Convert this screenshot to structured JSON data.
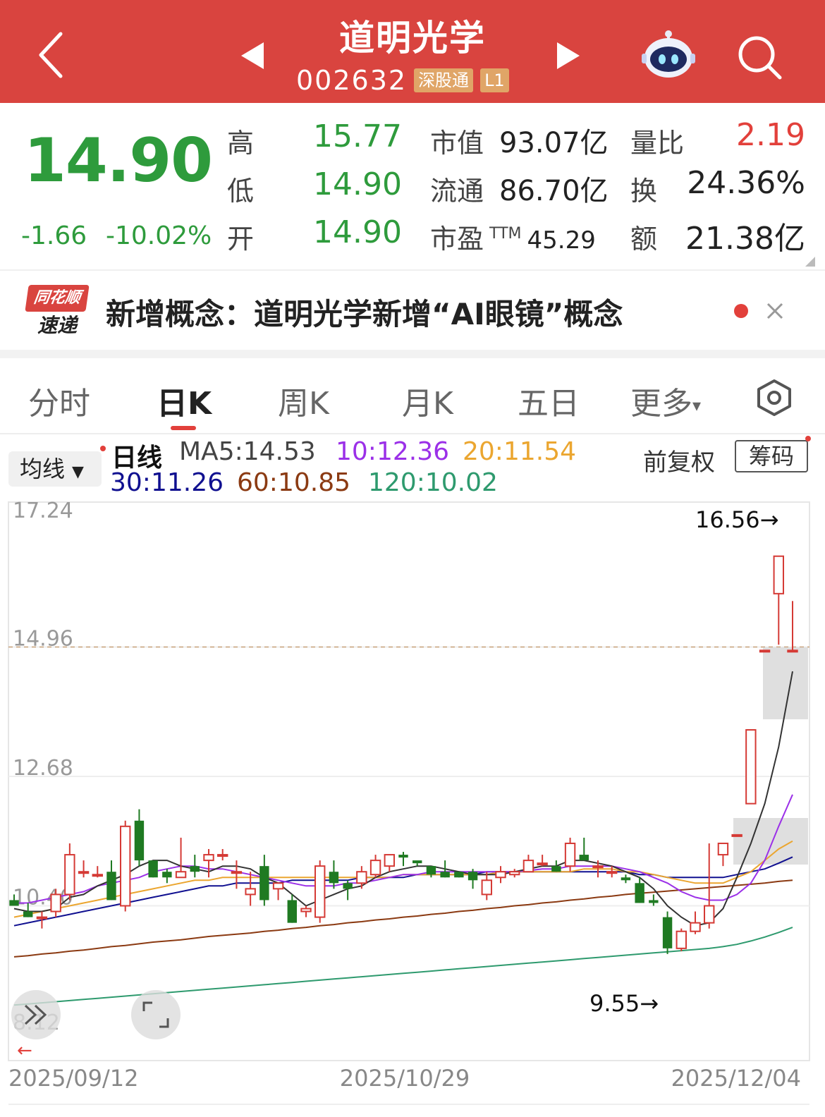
{
  "header": {
    "title": "道明光学",
    "code": "002632",
    "tag_connect": "深股通",
    "tag_level": "L1",
    "icons": [
      "back-icon",
      "prev-stock-icon",
      "next-stock-icon",
      "assistant-robot-icon",
      "search-icon"
    ]
  },
  "quote": {
    "price": "14.90",
    "change": "-1.66",
    "change_pct": "-10.02%",
    "high_label": "高",
    "high": "15.77",
    "low_label": "低",
    "low": "14.90",
    "open_label": "开",
    "open": "14.90",
    "mcap_label": "市值",
    "mcap": "93.07亿",
    "float_label": "流通",
    "float": "86.70亿",
    "pe_label": "市盈",
    "pe_ttm": "TTM",
    "pe": "45.29",
    "volratio_label": "量比",
    "volratio": "2.19",
    "turnover_label": "换",
    "turnover": "24.36%",
    "amount_label": "额",
    "amount": "21.38亿",
    "colors": {
      "down": "#2e9b3c",
      "up": "#e2403b"
    }
  },
  "news": {
    "logo_top": "同花顺",
    "logo_bottom": "速递",
    "text": "新增概念：道明光学新增“AI眼镜”概念"
  },
  "tabs": [
    "分时",
    "日K",
    "周K",
    "月K",
    "五日",
    "更多"
  ],
  "active_tab": "日K",
  "legend": {
    "selector": "均线",
    "period": "日线",
    "ma5": "MA5:14.53",
    "ma10": "10:12.36",
    "ma20": "20:11.54",
    "ma30": "30:11.26",
    "ma60": "60:10.85",
    "ma120": "120:10.02",
    "adjust": "前复权",
    "chip": "筹码",
    "colors": {
      "ma5": "#333333",
      "ma10": "#9b30e8",
      "ma20": "#eba630",
      "ma30": "#101090",
      "ma60": "#8b3a12",
      "ma120": "#2e9a6e"
    }
  },
  "chart_data": {
    "type": "candlestick",
    "y_ticks": [
      "17.24",
      "14.96",
      "12.68",
      "10.40",
      "8.12"
    ],
    "ylim": [
      8.12,
      17.24
    ],
    "x_ticks": [
      "2025/09/12",
      "2025/10/29",
      "2025/12/04"
    ],
    "annotations": {
      "max": "16.56→",
      "min": "9.55→",
      "last_close": 14.96
    },
    "grid": true,
    "candles": [
      [
        10.5,
        10.6,
        10.4,
        10.4
      ],
      [
        10.3,
        10.45,
        10.2,
        10.2
      ],
      [
        10.2,
        10.3,
        10.0,
        10.2
      ],
      [
        10.3,
        10.7,
        10.2,
        10.6
      ],
      [
        10.6,
        11.5,
        10.5,
        11.3
      ],
      [
        11.0,
        11.2,
        10.9,
        11.0
      ],
      [
        10.95,
        11.1,
        10.9,
        10.95
      ],
      [
        11.0,
        11.2,
        10.5,
        10.5
      ],
      [
        10.4,
        11.9,
        10.3,
        11.8
      ],
      [
        11.9,
        12.1,
        11.1,
        11.2
      ],
      [
        11.2,
        11.2,
        10.9,
        10.9
      ],
      [
        11.0,
        11.05,
        10.8,
        10.9
      ],
      [
        10.9,
        11.6,
        10.9,
        11.0
      ],
      [
        11.1,
        11.3,
        10.9,
        11.0
      ],
      [
        11.2,
        11.4,
        10.9,
        11.3
      ],
      [
        11.3,
        11.4,
        11.2,
        11.3
      ],
      [
        11.0,
        11.2,
        10.7,
        11.0
      ],
      [
        10.6,
        11.0,
        10.4,
        10.7
      ],
      [
        11.1,
        11.3,
        10.4,
        10.5
      ],
      [
        10.7,
        10.8,
        10.5,
        10.8
      ],
      [
        10.5,
        10.6,
        10.1,
        10.1
      ],
      [
        10.3,
        10.4,
        10.2,
        10.35
      ],
      [
        10.2,
        11.2,
        10.1,
        11.1
      ],
      [
        11.0,
        11.2,
        10.7,
        10.8
      ],
      [
        10.8,
        10.85,
        10.5,
        10.7
      ],
      [
        10.8,
        11.1,
        10.7,
        11.0
      ],
      [
        10.95,
        11.3,
        10.9,
        11.2
      ],
      [
        11.1,
        11.3,
        11.0,
        11.3
      ],
      [
        11.3,
        11.35,
        11.1,
        11.25
      ],
      [
        11.2,
        11.15,
        11.1,
        11.15
      ],
      [
        11.1,
        11.1,
        10.9,
        10.95
      ],
      [
        11.0,
        11.2,
        10.9,
        10.9
      ],
      [
        11.0,
        11.0,
        10.9,
        10.9
      ],
      [
        11.0,
        11.05,
        10.7,
        10.85
      ],
      [
        10.6,
        11.0,
        10.5,
        10.85
      ],
      [
        10.9,
        11.1,
        10.8,
        11.0
      ],
      [
        10.95,
        11.05,
        10.9,
        11.0
      ],
      [
        11.0,
        11.3,
        11.0,
        11.2
      ],
      [
        11.15,
        11.3,
        11.1,
        11.15
      ],
      [
        11.1,
        11.2,
        11.0,
        11.0
      ],
      [
        11.1,
        11.6,
        11.0,
        11.5
      ],
      [
        11.3,
        11.6,
        11.2,
        11.2
      ],
      [
        11.1,
        11.2,
        10.9,
        11.1
      ],
      [
        11.0,
        11.1,
        10.9,
        11.0
      ],
      [
        10.9,
        10.95,
        10.8,
        10.85
      ],
      [
        10.8,
        10.9,
        10.45,
        10.45
      ],
      [
        10.5,
        10.6,
        10.4,
        10.45
      ],
      [
        10.2,
        10.3,
        9.55,
        9.65
      ],
      [
        9.65,
        10.0,
        9.6,
        9.95
      ],
      [
        9.95,
        10.3,
        9.9,
        10.1
      ],
      [
        10.1,
        11.5,
        10.0,
        10.4
      ],
      [
        11.3,
        11.5,
        11.1,
        11.5
      ],
      [
        11.65,
        11.65,
        11.65,
        11.65
      ],
      [
        12.2,
        13.5,
        12.2,
        13.5
      ],
      [
        14.9,
        14.9,
        14.9,
        14.9
      ],
      [
        15.9,
        16.56,
        15.0,
        16.56
      ],
      [
        14.9,
        15.77,
        14.9,
        14.9
      ]
    ],
    "ma5": [
      10.35,
      10.3,
      10.3,
      10.35,
      10.55,
      10.6,
      10.75,
      10.85,
      10.95,
      11.1,
      11.2,
      11.2,
      11.1,
      11.05,
      11.0,
      11.1,
      11.1,
      11.05,
      10.9,
      10.8,
      10.6,
      10.4,
      10.5,
      10.6,
      10.7,
      10.75,
      10.9,
      11.0,
      11.05,
      11.1,
      11.1,
      11.05,
      11.0,
      10.95,
      10.95,
      10.95,
      11.0,
      11.05,
      11.1,
      11.1,
      11.2,
      11.2,
      11.15,
      11.1,
      11.0,
      10.9,
      10.7,
      10.4,
      10.2,
      10.05,
      10.1,
      10.35,
      10.9,
      11.5,
      12.2,
      13.2,
      14.53
    ],
    "ma10": [
      10.45,
      10.45,
      10.5,
      10.55,
      10.6,
      10.65,
      10.75,
      10.8,
      10.85,
      10.9,
      11.0,
      11.05,
      11.1,
      11.1,
      11.05,
      11.05,
      11.0,
      10.95,
      10.9,
      10.85,
      10.8,
      10.75,
      10.75,
      10.75,
      10.8,
      10.8,
      10.85,
      10.9,
      10.95,
      10.95,
      11.0,
      11.0,
      11.0,
      11.0,
      11.0,
      11.0,
      11.0,
      11.02,
      11.05,
      11.05,
      11.1,
      11.1,
      11.1,
      11.1,
      11.05,
      11.0,
      10.9,
      10.8,
      10.65,
      10.55,
      10.5,
      10.5,
      10.6,
      10.8,
      11.2,
      11.8,
      12.36
    ],
    "ma20": [
      10.2,
      10.25,
      10.3,
      10.35,
      10.4,
      10.45,
      10.5,
      10.55,
      10.6,
      10.65,
      10.7,
      10.75,
      10.8,
      10.85,
      10.85,
      10.9,
      10.9,
      10.9,
      10.9,
      10.9,
      10.9,
      10.9,
      10.9,
      10.9,
      10.9,
      10.9,
      10.9,
      10.9,
      10.95,
      10.95,
      10.95,
      10.95,
      10.95,
      10.95,
      10.95,
      11.0,
      11.0,
      11.0,
      11.0,
      11.0,
      11.0,
      11.05,
      11.05,
      11.05,
      11.0,
      11.0,
      10.95,
      10.9,
      10.85,
      10.8,
      10.8,
      10.8,
      10.9,
      11.0,
      11.2,
      11.4,
      11.54
    ],
    "ma30": [
      10.05,
      10.1,
      10.15,
      10.2,
      10.25,
      10.3,
      10.35,
      10.4,
      10.45,
      10.5,
      10.55,
      10.6,
      10.65,
      10.7,
      10.75,
      10.75,
      10.8,
      10.8,
      10.8,
      10.8,
      10.85,
      10.85,
      10.85,
      10.85,
      10.85,
      10.9,
      10.9,
      10.9,
      10.9,
      10.95,
      10.95,
      10.95,
      10.95,
      10.95,
      11.0,
      11.0,
      11.0,
      11.0,
      11.0,
      11.0,
      11.0,
      11.0,
      11.0,
      11.0,
      11.0,
      10.95,
      10.95,
      10.9,
      10.9,
      10.9,
      10.9,
      10.9,
      10.95,
      11.0,
      11.05,
      11.15,
      11.26
    ],
    "ma60": [
      9.5,
      9.52,
      9.55,
      9.57,
      9.6,
      9.62,
      9.65,
      9.68,
      9.7,
      9.73,
      9.76,
      9.78,
      9.8,
      9.83,
      9.86,
      9.88,
      9.9,
      9.92,
      9.95,
      9.97,
      10.0,
      10.02,
      10.05,
      10.07,
      10.1,
      10.12,
      10.15,
      10.17,
      10.2,
      10.22,
      10.25,
      10.27,
      10.3,
      10.32,
      10.35,
      10.37,
      10.4,
      10.42,
      10.45,
      10.47,
      10.5,
      10.52,
      10.55,
      10.57,
      10.6,
      10.62,
      10.64,
      10.66,
      10.68,
      10.7,
      10.72,
      10.74,
      10.76,
      10.78,
      10.8,
      10.83,
      10.85
    ],
    "ma120": [
      8.65,
      8.67,
      8.69,
      8.71,
      8.73,
      8.75,
      8.77,
      8.79,
      8.81,
      8.83,
      8.85,
      8.87,
      8.89,
      8.91,
      8.93,
      8.95,
      8.97,
      8.99,
      9.01,
      9.03,
      9.05,
      9.07,
      9.09,
      9.11,
      9.13,
      9.15,
      9.17,
      9.19,
      9.21,
      9.23,
      9.25,
      9.27,
      9.29,
      9.31,
      9.33,
      9.35,
      9.37,
      9.39,
      9.41,
      9.43,
      9.45,
      9.47,
      9.49,
      9.51,
      9.53,
      9.55,
      9.57,
      9.59,
      9.61,
      9.63,
      9.65,
      9.68,
      9.72,
      9.78,
      9.85,
      9.93,
      10.02
    ]
  }
}
